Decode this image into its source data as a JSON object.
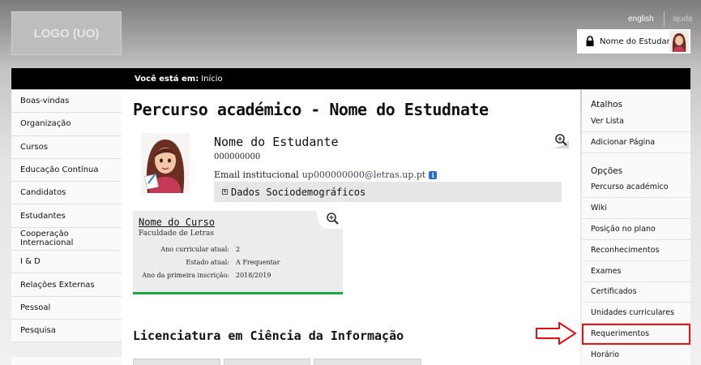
{
  "header": {
    "logo_text": "LOGO (UO)",
    "lang_en": "english",
    "lang_help": "ajuda",
    "user_name": "Nome do Estudante"
  },
  "breadcrumb": {
    "label": "Você está em:",
    "current": "Início"
  },
  "left_nav": {
    "items": [
      "Boas-vindas",
      "Organização",
      "Cursos",
      "Educação Contínua",
      "Candidatos",
      "Estudantes",
      "Cooperação Internacional",
      "I & D",
      "Relações Externas",
      "Pessoal",
      "Pesquisa"
    ]
  },
  "main": {
    "title": "Percurso académico - Nome do Estudnate",
    "student_name": "Nome do Estudante",
    "student_number": "000000000",
    "email_label": "Email institucional",
    "email_value": "up000000000@letras.up.pt",
    "info_icon": "i",
    "socio_label": "Dados Sociodemográficos",
    "course": {
      "name": "Nome do Curso",
      "faculty": "Faculdade de Letras",
      "year_label": "Ano curricular atual:",
      "year_value": "2",
      "state_label": "Estado atual:",
      "state_value": "A Frequentar",
      "first_label": "Ano da primeira inscrição:",
      "first_value": "2018/2019"
    },
    "degree_title": "Licenciatura em Ciência da Informação"
  },
  "right_nav": {
    "shortcuts_heading": "Atalhos",
    "shortcuts": [
      "Ver Lista",
      "Adicionar Página"
    ],
    "options_heading": "Opções",
    "options": [
      "Percurso académico",
      "Wiki",
      "Posição no plano",
      "Reconhecimentos",
      "Exames",
      "Certificados",
      "Unidades curriculares",
      "Requerimentos",
      "Horário"
    ],
    "highlighted": "Requerimentos"
  },
  "colors": {
    "accent_green": "#1da745",
    "highlight_red": "#e11111",
    "crumb_bar": "#000000"
  },
  "icons": [
    "lock-icon",
    "zoom-icon",
    "info-icon",
    "expand-icon",
    "arrow-right-icon"
  ]
}
